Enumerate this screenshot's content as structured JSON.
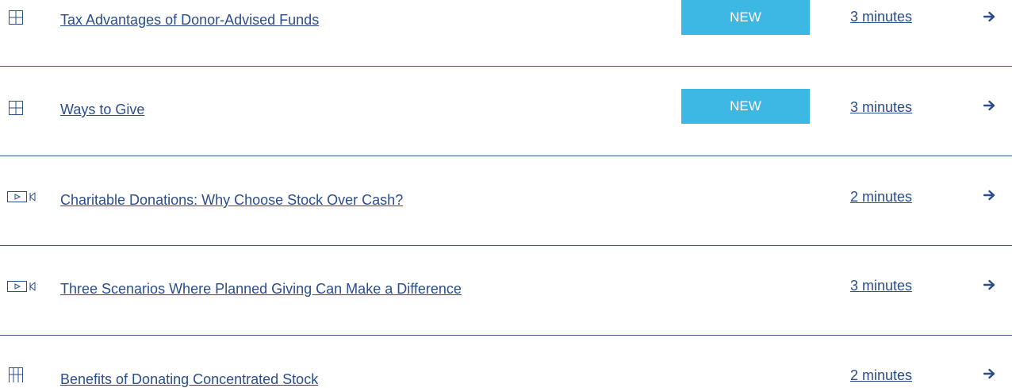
{
  "items": [
    {
      "icon": "article-icon",
      "title": "Tax Advantages of Donor-Advised Funds",
      "badge": "NEW",
      "duration": "3 minutes",
      "arrow": "arrow-right-icon"
    },
    {
      "icon": "article-icon",
      "title": "Ways to Give",
      "badge": "NEW",
      "duration": "3 minutes",
      "arrow": "arrow-right-icon"
    },
    {
      "icon": "video-icon",
      "title": "Charitable Donations: Why Choose Stock Over Cash?",
      "badge": "",
      "duration": "2 minutes",
      "arrow": "arrow-right-icon"
    },
    {
      "icon": "video-icon",
      "title": "Three Scenarios Where Planned Giving Can Make a Difference",
      "badge": "",
      "duration": "3 minutes",
      "arrow": "arrow-right-icon"
    },
    {
      "icon": "infographic-icon",
      "title": "Benefits of Donating Concentrated Stock",
      "badge": "",
      "duration": "2 minutes",
      "arrow": "arrow-right-icon"
    }
  ],
  "colors": {
    "link": "#2a4d8c",
    "divider": "#3a5a8c",
    "badge_background": "#3db8e4",
    "badge_text": "#ffffff",
    "arrow": "#2a4d8c",
    "icon": "#2a4d8c"
  }
}
